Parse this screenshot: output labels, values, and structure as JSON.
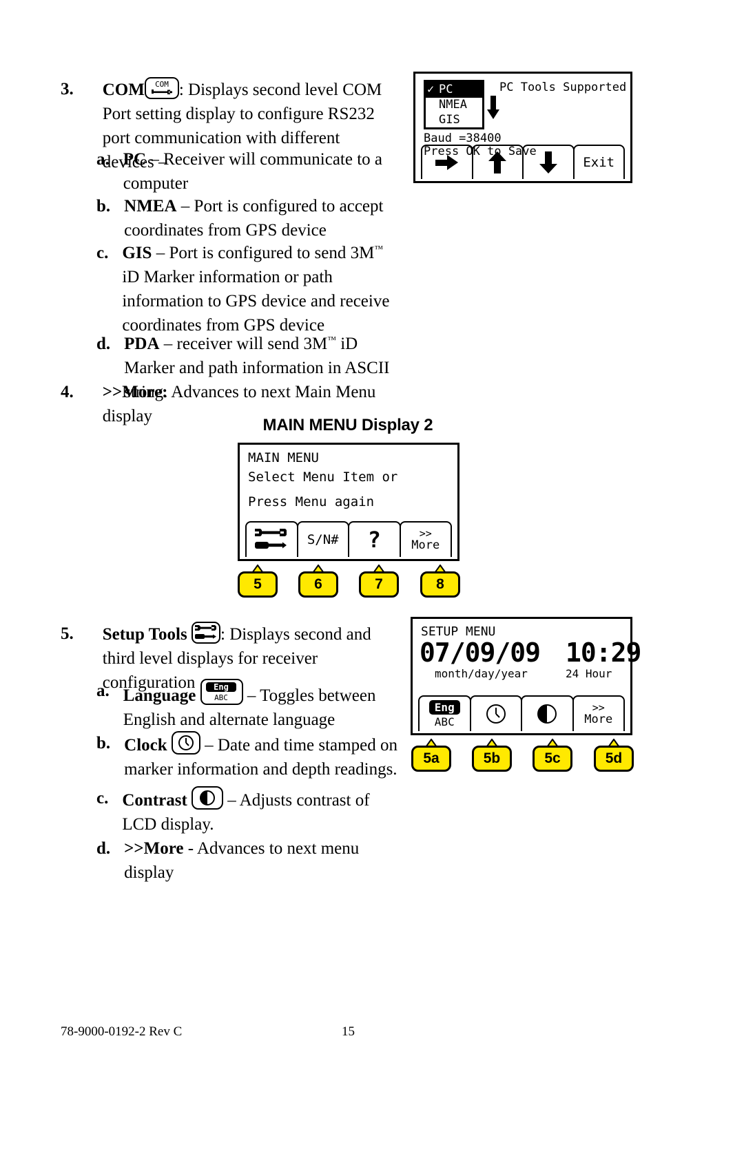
{
  "document": {
    "footer_left": "78-9000-0192-2 Rev C",
    "footer_page": "15"
  },
  "items": [
    {
      "number": "3.",
      "lead": "COM",
      "icon": "com-key-icon",
      "text_after": ": Displays second level COM Port setting display to configure RS232 port communication with different devices –"
    },
    {
      "number": "4.",
      "lead": ">>More:",
      "text_after": " Advances to next Main Menu display"
    },
    {
      "number": "5.",
      "lead": "Setup Tools",
      "icon": "setup-tools-key-icon",
      "text_after": ": Displays second and third level displays for receiver configuration"
    }
  ],
  "sub_items_3": [
    {
      "letter": "a.",
      "lead": "PC",
      "text": " – Receiver will communicate to a computer"
    },
    {
      "letter": "b.",
      "lead": "NMEA",
      "text": " – Port is configured to accept coordinates from GPS device"
    },
    {
      "letter": "c.",
      "lead": "GIS",
      "text_pre": " – Port is configured to send 3M",
      "tm": "™",
      "text_post": " iD Marker information or path information to GPS device and receive coordinates from GPS device"
    },
    {
      "letter": "d.",
      "lead": "PDA",
      "text_pre": " – receiver will send 3M",
      "tm": "™",
      "text_post": " iD Marker and path information in ASCII string."
    }
  ],
  "sub_items_5": [
    {
      "letter": "a.",
      "lead": "Language",
      "icon": "language-key-icon",
      "text": " – Toggles between English and alternate language"
    },
    {
      "letter": "b.",
      "lead": "Clock",
      "icon": "clock-key-icon",
      "text": " – Date and time stamped on marker information and depth readings."
    },
    {
      "letter": "c.",
      "lead": "Contrast",
      "icon": "contrast-key-icon",
      "text": " – Adjusts contrast of LCD display."
    },
    {
      "letter": "d.",
      "lead": ">>More",
      "text": " - Advances to next menu display"
    }
  ],
  "section_heading": "MAIN MENU Display 2",
  "com_screen": {
    "name": "COM Port Setting Display",
    "list": [
      {
        "label": "PC",
        "checked": true,
        "selected": true
      },
      {
        "label": "NMEA",
        "checked": false,
        "selected": false
      },
      {
        "label": "GIS",
        "checked": false,
        "selected": false
      }
    ],
    "title_right": "PC Tools Supported",
    "line_baud": "Baud =38400",
    "line_save": "Press OK to Save",
    "softkeys": [
      {
        "label": "",
        "icon": "arrow-right-icon"
      },
      {
        "label": "",
        "icon": "arrow-up-icon"
      },
      {
        "label": "",
        "icon": "arrow-down-icon"
      },
      {
        "label": "Exit",
        "icon": ""
      }
    ]
  },
  "main_menu_screen": {
    "name": "MAIN MENU Display 2",
    "line1": "MAIN MENU",
    "line2": "Select Menu Item or",
    "line3": "Press Menu again",
    "softkeys": [
      {
        "label": "",
        "icon": "setup-tools-icon"
      },
      {
        "label": "S/N#",
        "icon": ""
      },
      {
        "label": "?",
        "icon": "question-icon"
      },
      {
        "label": ">>\nMore",
        "icon": ""
      }
    ],
    "callouts": [
      "5",
      "6",
      "7",
      "8"
    ]
  },
  "setup_menu_screen": {
    "name": "SETUP MENU",
    "title": "SETUP MENU",
    "date": "07/09/09",
    "time": "10:29",
    "date_format": "month/day/year",
    "time_format": "24 Hour",
    "softkeys": [
      {
        "label_top": "Eng",
        "label_bottom": "ABC",
        "icon": ""
      },
      {
        "label": "",
        "icon": "clock-icon"
      },
      {
        "label": "",
        "icon": "contrast-icon"
      },
      {
        "label": ">>\nMore",
        "icon": ""
      }
    ],
    "callouts": [
      "5a",
      "5b",
      "5c",
      "5d"
    ]
  },
  "colors": {
    "callout_yellow": "#ffe900",
    "ink": "#000000",
    "paper": "#ffffff"
  }
}
